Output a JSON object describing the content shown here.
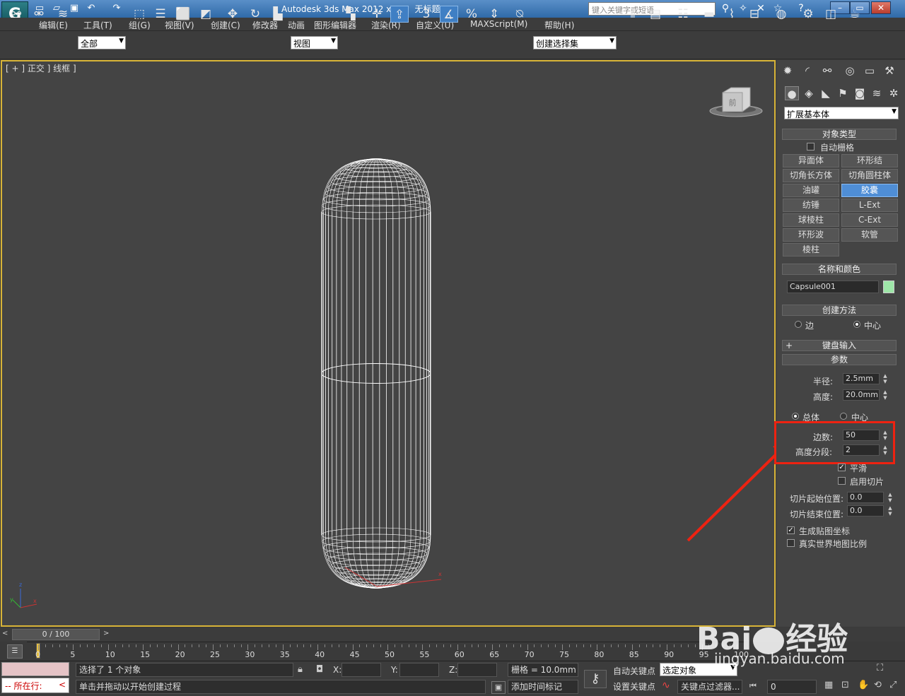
{
  "window": {
    "app": "Autodesk 3ds Max  2012 x64",
    "doc": "无标题",
    "search_placeholder": "键入关键字或短语"
  },
  "menu": [
    "编辑(E)",
    "工具(T)",
    "组(G)",
    "视图(V)",
    "创建(C)",
    "修改器",
    "动画",
    "图形编辑器",
    "渲染(R)",
    "自定义(U)",
    "MAXScript(M)",
    "帮助(H)"
  ],
  "toolbar": {
    "filter": "全部",
    "refcoord": "视图",
    "named_set": "创建选择集",
    "snap3": "3",
    "percent_icon": "%"
  },
  "viewport": {
    "label": "[ + ] 正交 ] 线框 ]",
    "viewcube_face": "前"
  },
  "panel": {
    "category": "扩展基本体",
    "object_type": {
      "title": "对象类型",
      "autogrid": "自动栅格",
      "buttons": [
        "异面体",
        "环形结",
        "切角长方体",
        "切角圆柱体",
        "油罐",
        "胶囊",
        "纺锤",
        "L-Ext",
        "球棱柱",
        "C-Ext",
        "环形波",
        "软管",
        "棱柱"
      ],
      "selected": "胶囊"
    },
    "name_color": {
      "title": "名称和颜色",
      "name": "Capsule001",
      "color": "#9ee6a8"
    },
    "creation": {
      "title": "创建方法",
      "opt1": "边",
      "opt2": "中心",
      "selected": "中心"
    },
    "keyboard": {
      "title": "键盘输入",
      "plus": "+"
    },
    "params": {
      "title": "参数",
      "radius_label": "半径:",
      "radius": "2.5mm",
      "height_label": "高度:",
      "height": "20.0mm",
      "overall": "总体",
      "center": "中心",
      "sides_label": "边数:",
      "sides": "50",
      "hsegs_label": "高度分段:",
      "hsegs": "2",
      "smooth": "平滑",
      "slice": "启用切片",
      "slice_from_label": "切片起始位置:",
      "slice_from": "0.0",
      "slice_to_label": "切片结束位置:",
      "slice_to": "0.0",
      "gen_map": "生成贴图坐标",
      "real_world": "真实世界地图比例"
    }
  },
  "timeline": {
    "slider": "0 / 100",
    "ticks": [
      "0",
      "5",
      "10",
      "15",
      "20",
      "25",
      "30",
      "35",
      "40",
      "45",
      "50",
      "55",
      "60",
      "65",
      "70",
      "75",
      "80",
      "85",
      "90",
      "95",
      "100"
    ]
  },
  "status": {
    "selected": "选择了 1 个对象",
    "prompt": "单击并拖动以开始创建过程",
    "running": "所在行:",
    "x": "X:",
    "y": "Y:",
    "z": "Z:",
    "grid": "栅格 = 10.0mm",
    "autokey": "自动关键点",
    "setkey": "设置关键点",
    "keymode": "选定对象",
    "keyfilter": "关键点过滤器...",
    "add_tag": "添加时间标记",
    "frame": "0"
  },
  "watermark": {
    "brand": "Bai",
    "brand_cn": "经验",
    "url": "jingyan.baidu.com"
  }
}
